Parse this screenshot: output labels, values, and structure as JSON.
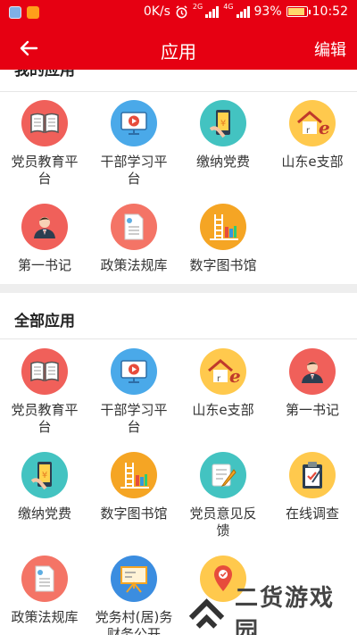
{
  "status": {
    "speed": "0K/s",
    "net_2g": "2G",
    "net_4g": "4G",
    "battery": "93%",
    "time": "10:52",
    "battery_level": 0.93
  },
  "appbar": {
    "title": "应用",
    "edit": "编辑"
  },
  "my_apps": {
    "title": "我的应用",
    "items": [
      {
        "label": "党员教育平台",
        "icon": "book-icon",
        "color": "#f0605a"
      },
      {
        "label": "干部学习平台",
        "icon": "video-play-icon",
        "color": "#4aa9e9"
      },
      {
        "label": "缴纳党费",
        "icon": "phone-payment-icon",
        "color": "#43c3c1"
      },
      {
        "label": "山东e支部",
        "icon": "house-e-icon",
        "color": "#ffc94d"
      },
      {
        "label": "第一书记",
        "icon": "person-icon",
        "color": "#f0605a"
      },
      {
        "label": "政策法规库",
        "icon": "document-icon",
        "color": "#f47466"
      },
      {
        "label": "数字图书馆",
        "icon": "library-icon",
        "color": "#f5a524"
      }
    ]
  },
  "all_apps": {
    "title": "全部应用",
    "items": [
      {
        "label": "党员教育平台",
        "icon": "book-icon",
        "color": "#f0605a"
      },
      {
        "label": "干部学习平台",
        "icon": "video-play-icon",
        "color": "#4aa9e9"
      },
      {
        "label": "山东e支部",
        "icon": "house-e-icon",
        "color": "#ffc94d"
      },
      {
        "label": "第一书记",
        "icon": "person-icon",
        "color": "#f0605a"
      },
      {
        "label": "缴纳党费",
        "icon": "phone-payment-icon",
        "color": "#43c3c1"
      },
      {
        "label": "数字图书馆",
        "icon": "library-icon",
        "color": "#f5a524"
      },
      {
        "label": "党员意见反馈",
        "icon": "feedback-pencil-icon",
        "color": "#43c3c1"
      },
      {
        "label": "在线调查",
        "icon": "clipboard-icon",
        "color": "#ffc94d"
      },
      {
        "label": "政策法规库",
        "icon": "document-icon",
        "color": "#f47466"
      },
      {
        "label": "党务村(居)务财务公开",
        "icon": "presentation-board-icon",
        "color": "#3b8de0"
      },
      {
        "label": "",
        "icon": "location-pin-icon",
        "color": "#ffc94d"
      }
    ]
  },
  "watermark": {
    "text": "二货游戏园"
  },
  "colors": {
    "brand_red": "#e60012"
  }
}
